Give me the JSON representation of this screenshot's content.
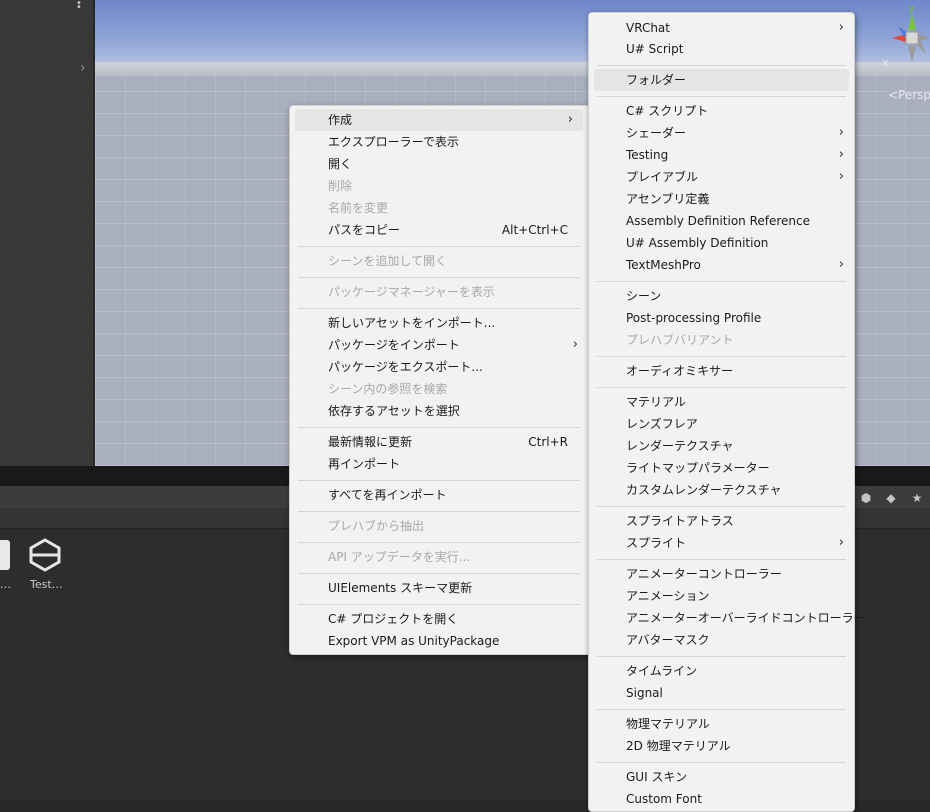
{
  "scene": {
    "persp_label": "<Persp",
    "gizmo_y": "y",
    "gizmo_x": "x"
  },
  "project": {
    "asset_label": "Test…",
    "asset_label_left": "…"
  },
  "context_menu": {
    "items": [
      {
        "label": "作成",
        "submenu": true,
        "highlighted": true
      },
      {
        "label": "エクスプローラーで表示"
      },
      {
        "label": "開く"
      },
      {
        "label": "削除",
        "disabled": true
      },
      {
        "label": "名前を変更",
        "disabled": true
      },
      {
        "label": "パスをコピー",
        "shortcut": "Alt+Ctrl+C"
      },
      {
        "label": "シーンを追加して開く",
        "disabled": true
      },
      {
        "label": "パッケージマネージャーを表示",
        "disabled": true
      },
      {
        "label": "新しいアセットをインポート..."
      },
      {
        "label": "パッケージをインポート",
        "submenu": true
      },
      {
        "label": "パッケージをエクスポート..."
      },
      {
        "label": "シーン内の参照を検索",
        "disabled": true
      },
      {
        "label": "依存するアセットを選択"
      },
      {
        "label": "最新情報に更新",
        "shortcut": "Ctrl+R"
      },
      {
        "label": "再インポート"
      },
      {
        "label": "すべてを再インポート"
      },
      {
        "label": "プレハブから抽出",
        "disabled": true
      },
      {
        "label": "API アップデータを実行...",
        "disabled": true
      },
      {
        "label": "UIElements スキーマ更新"
      },
      {
        "label": "C# プロジェクトを開く"
      },
      {
        "label": "Export VPM as UnityPackage"
      }
    ]
  },
  "create_submenu": {
    "items": [
      {
        "label": "VRChat",
        "submenu": true
      },
      {
        "label": "U# Script"
      },
      {
        "label": "フォルダー",
        "highlighted": true
      },
      {
        "label": "C# スクリプト"
      },
      {
        "label": "シェーダー",
        "submenu": true
      },
      {
        "label": "Testing",
        "submenu": true
      },
      {
        "label": "プレイアブル",
        "submenu": true
      },
      {
        "label": "アセンブリ定義"
      },
      {
        "label": "Assembly Definition Reference"
      },
      {
        "label": "U# Assembly Definition"
      },
      {
        "label": "TextMeshPro",
        "submenu": true
      },
      {
        "label": "シーン"
      },
      {
        "label": "Post-processing Profile"
      },
      {
        "label": "プレハブバリアント",
        "disabled": true
      },
      {
        "label": "オーディオミキサー"
      },
      {
        "label": "マテリアル"
      },
      {
        "label": "レンズフレア"
      },
      {
        "label": "レンダーテクスチャ"
      },
      {
        "label": "ライトマップパラメーター"
      },
      {
        "label": "カスタムレンダーテクスチャ"
      },
      {
        "label": "スプライトアトラス"
      },
      {
        "label": "スプライト",
        "submenu": true
      },
      {
        "label": "アニメーターコントローラー"
      },
      {
        "label": "アニメーション"
      },
      {
        "label": "アニメーターオーバーライドコントローラー"
      },
      {
        "label": "アバターマスク"
      },
      {
        "label": "タイムライン"
      },
      {
        "label": "Signal"
      },
      {
        "label": "物理マテリアル"
      },
      {
        "label": "2D 物理マテリアル"
      },
      {
        "label": "GUI スキン"
      },
      {
        "label": "Custom Font"
      }
    ]
  }
}
